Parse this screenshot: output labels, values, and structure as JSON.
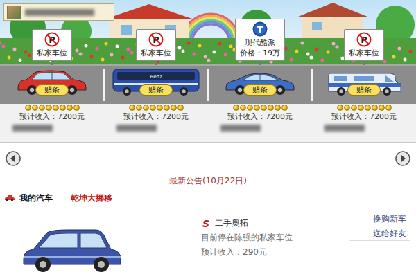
{
  "spots": [
    {
      "kind": "private",
      "icon": "P",
      "sign": "私家车位",
      "ticket": "贴条",
      "coins": 8,
      "income": "预计收入：7200元",
      "car": {
        "kind": "sedan",
        "color": "#d8322a"
      }
    },
    {
      "kind": "private",
      "icon": "P",
      "sign": "私家车位",
      "ticket": "贴条",
      "coins": 8,
      "income": "预计收入：7200元",
      "car": {
        "kind": "bus",
        "color": "#2a4fa8",
        "badge": "Benz"
      }
    },
    {
      "kind": "brand",
      "icon": "T",
      "sign": "现代酷派",
      "price": "价格：19万",
      "ticket": "贴条",
      "coins": 8,
      "income": "预计收入：7200元",
      "car": {
        "kind": "coupe",
        "color": "#3a6fc8"
      }
    },
    {
      "kind": "private",
      "icon": "P",
      "sign": "私家车位",
      "ticket": "贴条",
      "coins": 8,
      "income": "预计收入：7200元",
      "car": {
        "kind": "rv",
        "color": "#3a68c0"
      }
    }
  ],
  "notice": "最新公告(10月22日)",
  "my_car": {
    "title": "我的汽车",
    "action": "乾坤大挪移",
    "brand_icon": "S",
    "name": "二手奥拓",
    "location": "目前停在陈强的私家车位",
    "income": "预计收入：290元",
    "color": "#3d55a8",
    "links": [
      "换购新车",
      "送给好友"
    ]
  }
}
